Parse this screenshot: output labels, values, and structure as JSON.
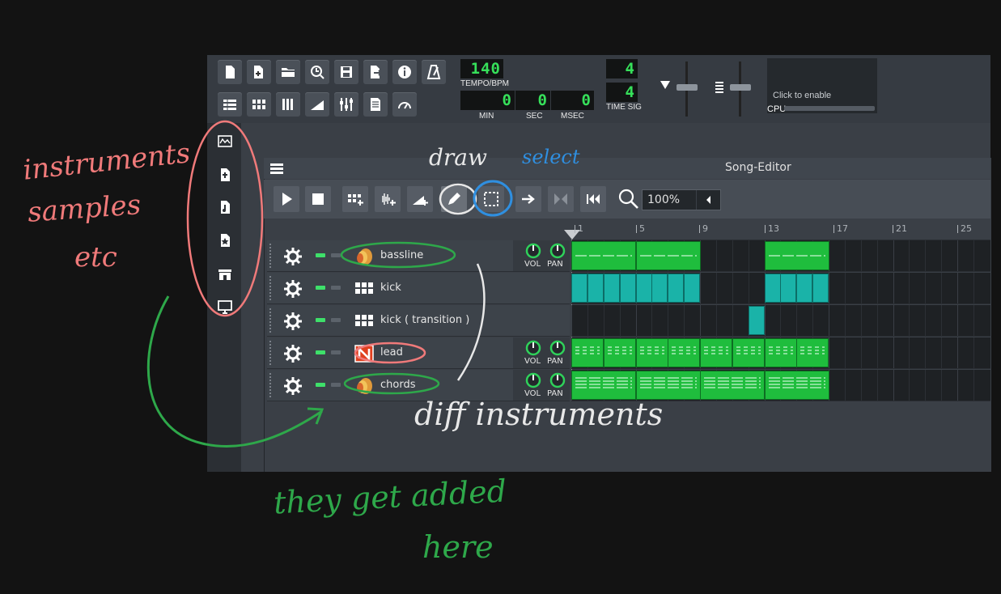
{
  "toolbar": {
    "tempo_value": "140",
    "tempo_label": "TEMPO/BPM",
    "min_value": "0",
    "sec_value": "0",
    "msec_value": "0",
    "min_label": "MIN",
    "sec_label": "SEC",
    "msec_label": "MSEC",
    "timesig_num": "4",
    "timesig_den": "4",
    "timesig_label": "TIME SIG",
    "click_to_enable": "Click to enable",
    "cpu_label": "CPU"
  },
  "song_editor": {
    "title": "Song-Editor",
    "zoom": "100%",
    "timeline_ticks": [
      "1",
      "5",
      "9",
      "13",
      "17",
      "21",
      "25"
    ],
    "knob_labels": {
      "vol": "VOL",
      "pan": "PAN"
    },
    "tracks": [
      {
        "name": "bassline"
      },
      {
        "name": "kick"
      },
      {
        "name": "kick ( transition )"
      },
      {
        "name": "lead"
      },
      {
        "name": "chords"
      }
    ]
  },
  "annotations": {
    "instruments": "instruments",
    "samples": "samples",
    "etc": "etc",
    "draw": "draw",
    "select": "select",
    "diff_instruments": "diff instruments",
    "they_get_added": "they get added",
    "here": "here"
  },
  "colors": {
    "pattern_green": "#1fbd3d",
    "pattern_cyan": "#1ab3a8",
    "lcd_green": "#36e05a",
    "annotation_red": "#f07a7a",
    "annotation_green": "#2ea84a",
    "annotation_blue": "#2f8fe0",
    "annotation_white": "#e8e8e8"
  }
}
